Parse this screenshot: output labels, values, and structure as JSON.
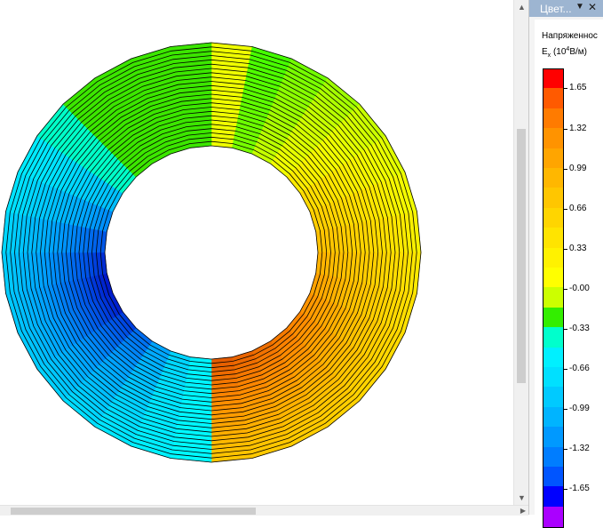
{
  "panel": {
    "title": "Цвет...",
    "legend_title": "Напряженнос",
    "units": {
      "symbol": "E",
      "sub": "x",
      "open": " (10",
      "exp": "4",
      "close": "В/м)"
    }
  },
  "legend": {
    "colors": [
      "#ff0000",
      "#ff5a00",
      "#ff7b00",
      "#ff9300",
      "#ffa500",
      "#ffb700",
      "#ffc600",
      "#ffd500",
      "#ffe400",
      "#fff200",
      "#ffff00",
      "#ccff00",
      "#33ee00",
      "#00ffcc",
      "#00f0ff",
      "#00e0ff",
      "#00caff",
      "#00b4ff",
      "#0099ff",
      "#007dff",
      "#0055ff",
      "#0000ff",
      "#aa00ff"
    ],
    "labels": [
      "1.65",
      "1.32",
      "0.99",
      "0.66",
      "0.33",
      "-0.00",
      "-0.33",
      "-0.66",
      "-0.99",
      "-1.32",
      "-1.65"
    ]
  },
  "icons": {
    "pin": "pin-icon",
    "close": "close-icon",
    "scroll_up": "scroll-up-arrow-icon",
    "scroll_down": "scroll-down-arrow-icon",
    "scroll_right": "scroll-right-arrow-icon"
  }
}
